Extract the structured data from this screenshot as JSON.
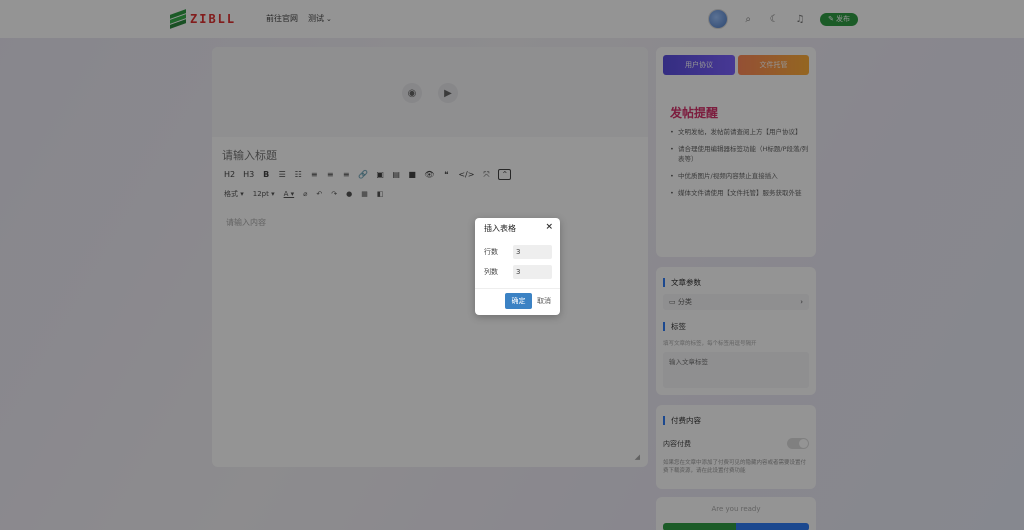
{
  "header": {
    "logo_text": "ZIBLL",
    "nav": [
      {
        "label": "前往官网"
      },
      {
        "label": "测试"
      }
    ],
    "post_label": "发布"
  },
  "editor": {
    "title_placeholder": "请输入标题",
    "content_placeholder": "请输入内容",
    "toolbar_row1": [
      "H2",
      "H3",
      "B",
      "☰",
      "☷",
      "≡",
      "≡",
      "≡",
      "🔗",
      "▣",
      "▤",
      "■",
      "👁",
      "❝",
      "</>",
      "⤧"
    ],
    "toolbar_row2": {
      "format": "格式",
      "font_size": "12pt",
      "items": [
        "⌀",
        "↶",
        "↷",
        "●",
        "▦",
        "◧"
      ]
    }
  },
  "sidebar": {
    "buttons": {
      "agreement": "用户协议",
      "hosting": "文件托管"
    },
    "remind_title": "发帖提醒",
    "remind_items": [
      "文明发帖，发帖前请查阅上方【用户协议】",
      "请合理使用编辑器标签功能（H标题/P段落/列表等）",
      "中优质图片/视频内容禁止直接插入",
      "媒体文件请使用【文件托管】服务获取外链"
    ],
    "article_params": {
      "heading": "文章参数",
      "category_label": "分类",
      "tags_heading": "标签",
      "tags_hint": "填写文章的标签，每个标签用逗号隔开",
      "tags_placeholder": "输入文章标签"
    },
    "paid": {
      "heading": "付费内容",
      "toggle_label": "内容付费",
      "desc": "如果您在文章中添加了付费可见的隐藏内容或者需要设置付费下载资源，请在此设置付费功能"
    },
    "ready": {
      "label": "Are you ready"
    }
  },
  "modal": {
    "title": "插入表格",
    "close": "×",
    "rows_label": "行数",
    "rows_value": "3",
    "cols_label": "列数",
    "cols_value": "3",
    "ok": "确定",
    "cancel": "取消"
  }
}
